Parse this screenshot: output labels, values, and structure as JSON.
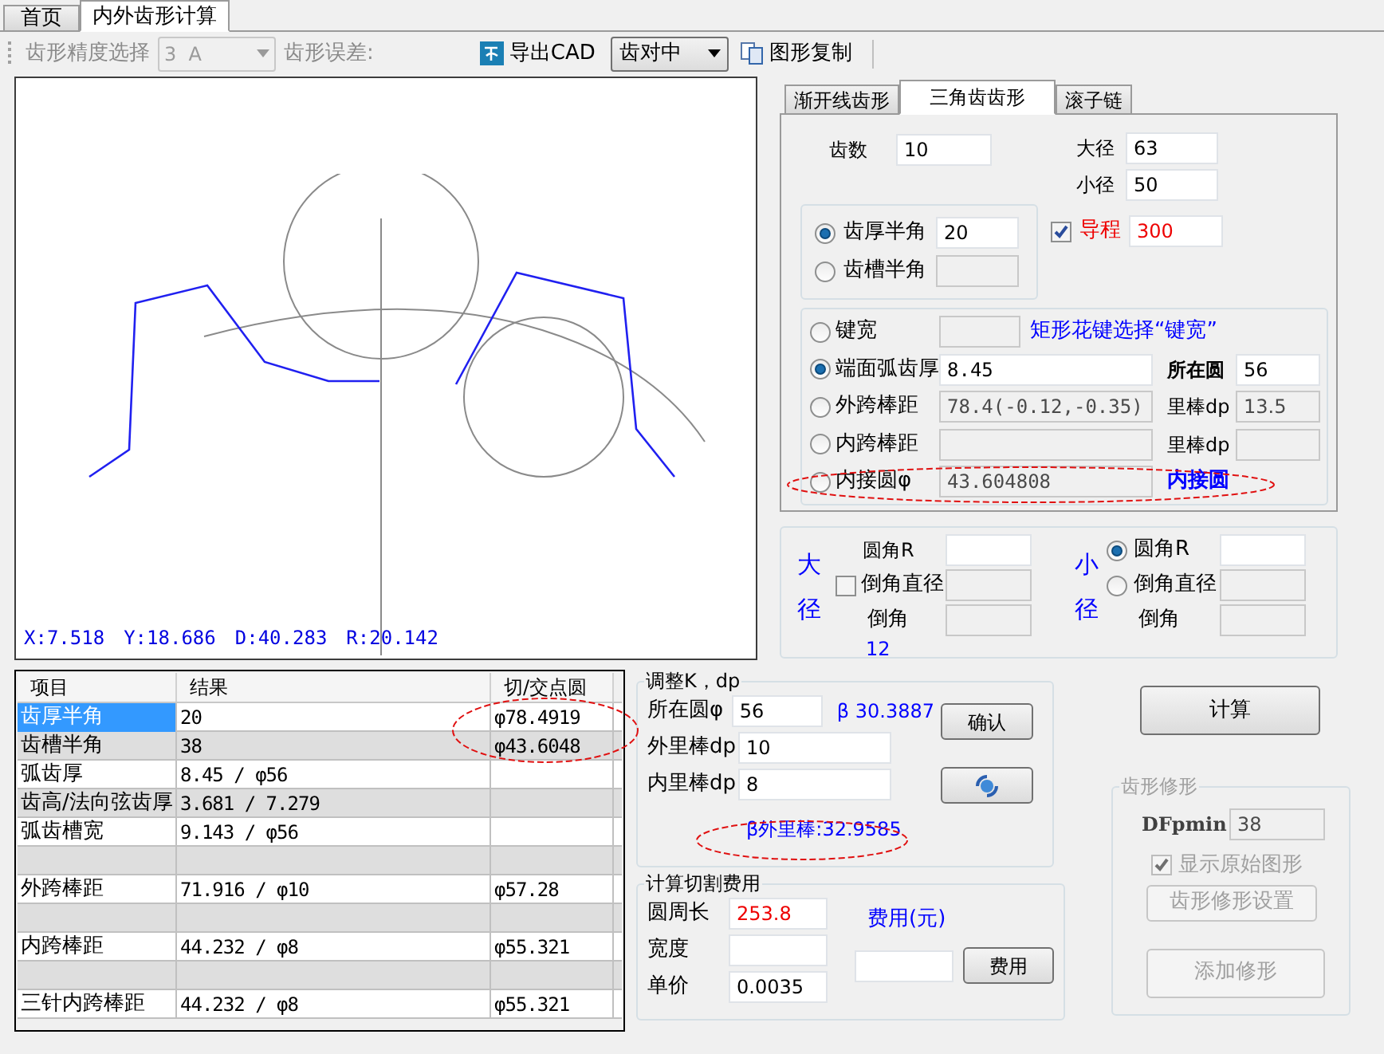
{
  "page_tabs": [
    {
      "label": "首页",
      "selected": false
    },
    {
      "label": "内外齿形计算",
      "selected": true
    }
  ],
  "toolbar": {
    "precision_label": "齿形精度选择",
    "precision_value": "3  A",
    "precision_disabled": true,
    "error_label": "齿形误差:",
    "export_button": "导出CAD",
    "alignment_value": "齿对中",
    "copy_button": "图形复制"
  },
  "canvas": {
    "readouts": [
      "X:7.518",
      "Y:18.686",
      "D:40.283",
      "R:20.142"
    ]
  },
  "results_table": {
    "columns": [
      "项目",
      "结果",
      "切/交点圆"
    ],
    "rows": [
      {
        "kind": "data",
        "item": "齿厚半角",
        "result": "20",
        "point": "φ78.4919",
        "selected": true
      },
      {
        "kind": "data",
        "item": "齿槽半角",
        "result": "38",
        "point": "φ43.6048",
        "selected": false
      },
      {
        "kind": "data",
        "item": "弧齿厚",
        "result": "8.45 / φ56",
        "selected": false
      },
      {
        "kind": "data",
        "item": "齿高/法向弦齿厚",
        "result": "3.681 / 7.279",
        "selected": false
      },
      {
        "kind": "data",
        "item": "弧齿槽宽",
        "result": "9.143 / φ56",
        "selected": false
      },
      {
        "kind": "blank",
        "selected": false
      },
      {
        "kind": "data",
        "item": "外跨棒距",
        "result": "71.916 / φ10",
        "point": "φ57.28",
        "selected": false
      },
      {
        "kind": "blank",
        "selected": false
      },
      {
        "kind": "data",
        "item": "内跨棒距",
        "result": "44.232 / φ8",
        "point": "φ55.321",
        "selected": false
      },
      {
        "kind": "blank",
        "selected": false
      },
      {
        "kind": "data",
        "item": "三针内跨棒距",
        "result": "44.232 / φ8",
        "point": "φ55.321",
        "selected": false
      }
    ]
  },
  "profile_tabs": [
    {
      "label": "渐开线齿形",
      "selected": false
    },
    {
      "label": "三角齿齿形",
      "selected": true
    },
    {
      "label": "滚子链",
      "selected": false
    }
  ],
  "triangle": {
    "tooth_count": {
      "label": "齿数",
      "value": "10"
    },
    "major_diameter": {
      "label": "大径",
      "value": "63"
    },
    "minor_diameter": {
      "label": "小径",
      "value": "50"
    },
    "half_angles": [
      {
        "label": "齿厚半角",
        "value": "20",
        "selected": true,
        "disabled": false
      },
      {
        "label": "齿槽半角",
        "selected": false,
        "disabled": true
      }
    ],
    "lead": {
      "label": "导程",
      "value": "300",
      "checked": true
    },
    "thickness_options": [
      {
        "label": "键宽",
        "selected": false,
        "disabled": true,
        "note": "矩形花键选择“键宽”"
      },
      {
        "label": "端面弧齿厚",
        "value": "8.45",
        "selected": true,
        "disabled": false,
        "extra_label": "所在圆",
        "extra_value": "56",
        "extra_disabled": false
      },
      {
        "label": "外跨棒距",
        "value": "78.4(-0.12,-0.35)",
        "selected": false,
        "disabled": true,
        "extra_label": "里棒dp",
        "extra_value": "13.5",
        "extra_disabled": true
      },
      {
        "label": "内跨棒距",
        "selected": false,
        "disabled": true,
        "extra_label": "里棒dp",
        "extra_disabled": true
      },
      {
        "label": "内接圆φ",
        "value": "43.604808",
        "selected": false,
        "disabled": true,
        "note": "内接圆"
      }
    ]
  },
  "corners": {
    "major": {
      "title": [
        "大",
        "径"
      ],
      "round_label": "圆角R",
      "chamfer_label": "倒角直径",
      "chamfer_checked": false,
      "angle_label": "倒角",
      "angle_note": "12"
    },
    "minor": {
      "title": [
        "小",
        "径"
      ],
      "options": [
        {
          "label": "圆角R",
          "selected": true
        },
        {
          "label": "倒角直径",
          "selected": false
        }
      ],
      "angle_label": "倒角"
    }
  },
  "adjust": {
    "title": "调整K，dp",
    "circle": {
      "label": "所在圆φ",
      "value": "56"
    },
    "beta": "β 30.3887",
    "outer_pin": {
      "label": "外里棒dp",
      "value": "10"
    },
    "inner_pin": {
      "label": "内里棒dp",
      "value": "8"
    },
    "beta_outer": "β外里棒:32.9585",
    "confirm_button": "确认"
  },
  "cost": {
    "title": "计算切割费用",
    "perimeter": {
      "label": "圆周长",
      "value": "253.8"
    },
    "width": {
      "label": "宽度"
    },
    "unit_price": {
      "label": "单价",
      "value": "0.0035"
    },
    "cost_label": "费用(元)",
    "cost_button": "费用"
  },
  "calculate_button": "计算",
  "modify": {
    "title": "齿形修形",
    "disabled": true,
    "dfpmin_label": "DFpmin",
    "dfpmin_value": "38",
    "show_original": {
      "label": "显示原始图形",
      "checked": true
    },
    "settings_button": "齿形修形设置",
    "add_button": "添加修形"
  }
}
